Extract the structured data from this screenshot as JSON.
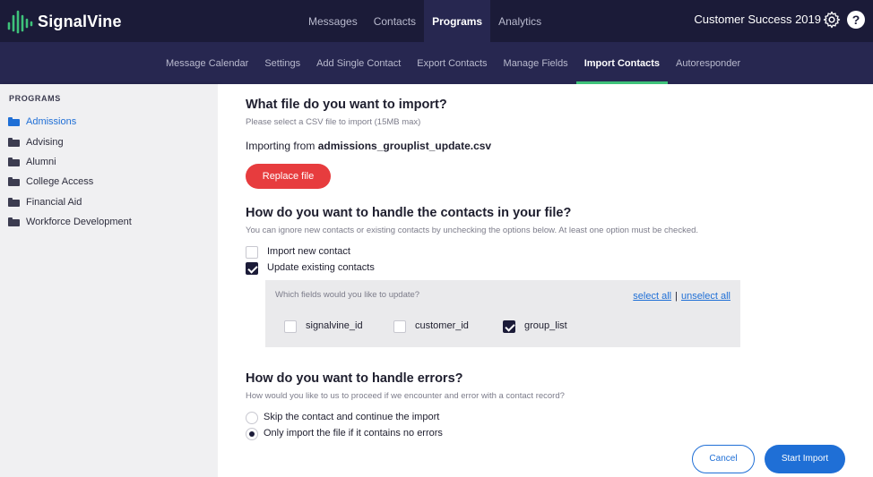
{
  "brand": {
    "name": "SignalVine",
    "accent": "#3ec27a"
  },
  "topnav": {
    "items": [
      {
        "label": "Messages"
      },
      {
        "label": "Contacts"
      },
      {
        "label": "Programs"
      },
      {
        "label": "Analytics"
      }
    ],
    "active_index": 2,
    "account": "Customer Success 2019",
    "help": "?"
  },
  "subnav": {
    "items": [
      {
        "label": "Message Calendar"
      },
      {
        "label": "Settings"
      },
      {
        "label": "Add Single Contact"
      },
      {
        "label": "Export Contacts"
      },
      {
        "label": "Manage Fields"
      },
      {
        "label": "Import Contacts"
      },
      {
        "label": "Autoresponder"
      }
    ],
    "active_index": 5
  },
  "sidebar": {
    "heading": "PROGRAMS",
    "items": [
      {
        "label": "Admissions"
      },
      {
        "label": "Advising"
      },
      {
        "label": "Alumni"
      },
      {
        "label": "College Access"
      },
      {
        "label": "Financial Aid"
      },
      {
        "label": "Workforce Development"
      }
    ],
    "active_index": 0
  },
  "main": {
    "file_section": {
      "title": "What file do you want to import?",
      "hint": "Please select a CSV file to import (15MB max)",
      "importing_prefix": "Importing from ",
      "filename": "admissions_grouplist_update.csv",
      "replace_button": "Replace file"
    },
    "contacts_section": {
      "title": "How do you want to handle the contacts in your file?",
      "hint": "You can ignore new contacts or existing contacts by unchecking the options below. At least one option must be checked.",
      "options": [
        {
          "label": "Import new contact",
          "checked": false
        },
        {
          "label": "Update existing contacts",
          "checked": true
        }
      ],
      "fields_question": "Which fields would you like to update?",
      "select_all": "select all",
      "separator": "|",
      "unselect_all": "unselect all",
      "fields": [
        {
          "label": "signalvine_id",
          "checked": false
        },
        {
          "label": "customer_id",
          "checked": false
        },
        {
          "label": "group_list",
          "checked": true
        }
      ]
    },
    "errors_section": {
      "title": "How do you want to handle errors?",
      "hint": "How would you like to us to proceed if we encounter and error with a contact record?",
      "options": [
        {
          "label": "Skip the contact and continue the import",
          "selected": false
        },
        {
          "label": "Only import the file if it contains no errors",
          "selected": true
        }
      ]
    },
    "actions": {
      "cancel": "Cancel",
      "start": "Start Import"
    }
  }
}
